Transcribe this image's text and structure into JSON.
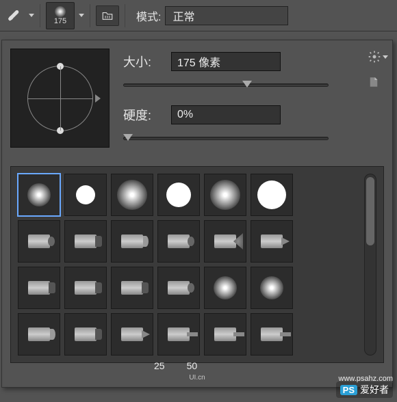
{
  "toolbar": {
    "brush_size_display": "175",
    "mode_label": "模式:",
    "mode_value": "正常"
  },
  "panel": {
    "size_label": "大小:",
    "size_value": "175 像素",
    "size_slider_pos": 58,
    "hardness_label": "硬度:",
    "hardness_value": "0%",
    "hardness_slider_pos": 0
  },
  "presets": {
    "labels": {
      "a": "25",
      "b": "50"
    },
    "uicn": "UI.cn"
  },
  "watermark": {
    "ps": "PS",
    "text": "爱好者",
    "url": "www.psahz.com"
  }
}
